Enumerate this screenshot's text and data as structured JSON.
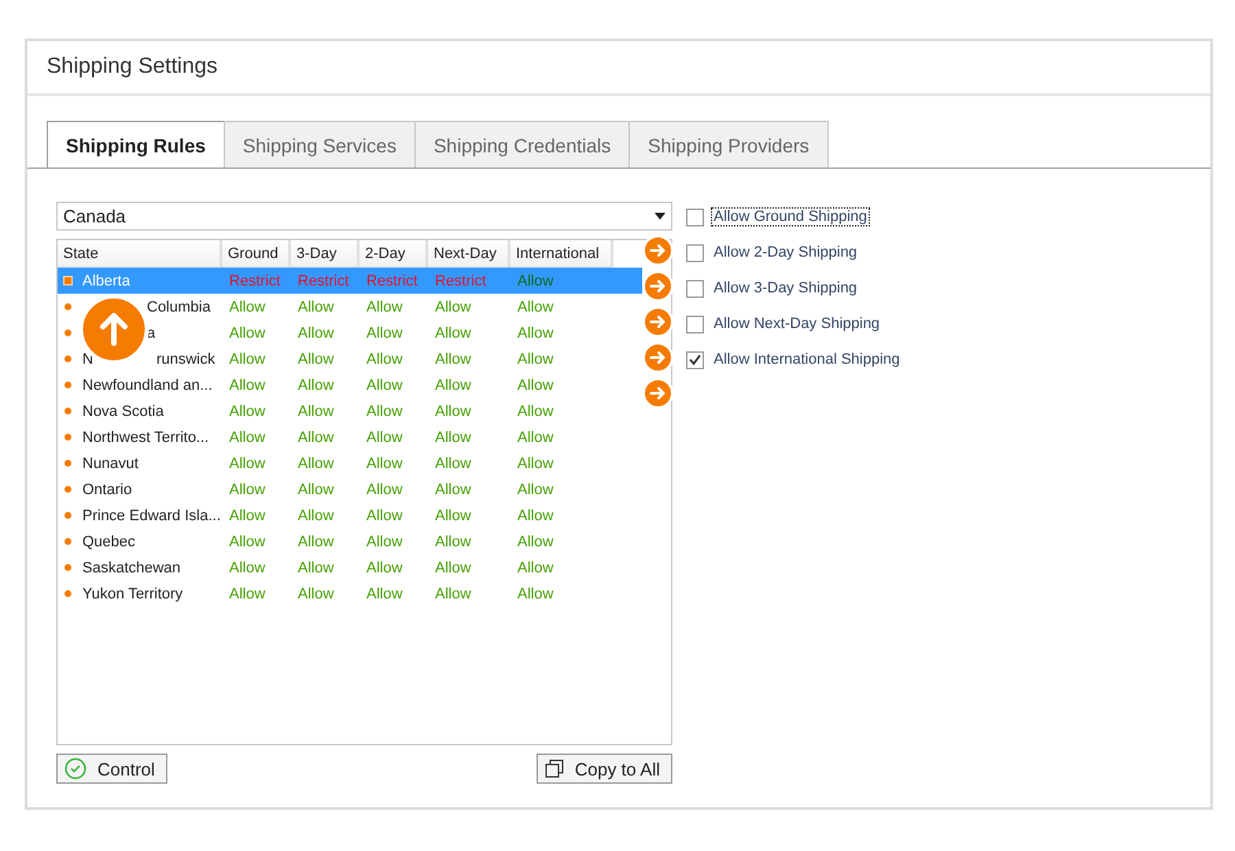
{
  "panel": {
    "title": "Shipping Settings"
  },
  "tabs": [
    {
      "label": "Shipping Rules",
      "selected": true
    },
    {
      "label": "Shipping Services",
      "selected": false
    },
    {
      "label": "Shipping Credentials",
      "selected": false
    },
    {
      "label": "Shipping Providers",
      "selected": false
    }
  ],
  "country_select": {
    "value": "Canada"
  },
  "table": {
    "columns": [
      "State",
      "Ground",
      "3-Day",
      "2-Day",
      "Next-Day",
      "International"
    ],
    "rows": [
      {
        "selected": true,
        "cells": [
          {
            "text": "Alberta",
            "kind": "state"
          },
          {
            "text": "Restrict",
            "kind": "restrict"
          },
          {
            "text": "Restrict",
            "kind": "restrict"
          },
          {
            "text": "Restrict",
            "kind": "restrict"
          },
          {
            "text": "Restrict",
            "kind": "restrict"
          },
          {
            "text": "Allow",
            "kind": "allow"
          }
        ]
      },
      {
        "selected": false,
        "covered": true,
        "cells": [
          {
            "text": "Columbia",
            "kind": "state"
          },
          {
            "text": "Allow",
            "kind": "allow"
          },
          {
            "text": "Allow",
            "kind": "allow"
          },
          {
            "text": "Allow",
            "kind": "allow"
          },
          {
            "text": "Allow",
            "kind": "allow"
          },
          {
            "text": "Allow",
            "kind": "allow"
          }
        ]
      },
      {
        "selected": false,
        "covered": true,
        "cells": [
          {
            "text": "a",
            "kind": "state"
          },
          {
            "text": "Allow",
            "kind": "allow"
          },
          {
            "text": "Allow",
            "kind": "allow"
          },
          {
            "text": "Allow",
            "kind": "allow"
          },
          {
            "text": "Allow",
            "kind": "allow"
          },
          {
            "text": "Allow",
            "kind": "allow"
          }
        ]
      },
      {
        "selected": false,
        "covered": true,
        "lead": "N",
        "cells": [
          {
            "text": "runswick",
            "kind": "state"
          },
          {
            "text": "Allow",
            "kind": "allow"
          },
          {
            "text": "Allow",
            "kind": "allow"
          },
          {
            "text": "Allow",
            "kind": "allow"
          },
          {
            "text": "Allow",
            "kind": "allow"
          },
          {
            "text": "Allow",
            "kind": "allow"
          }
        ]
      },
      {
        "selected": false,
        "cells": [
          {
            "text": "Newfoundland an...",
            "kind": "state"
          },
          {
            "text": "Allow",
            "kind": "allow"
          },
          {
            "text": "Allow",
            "kind": "allow"
          },
          {
            "text": "Allow",
            "kind": "allow"
          },
          {
            "text": "Allow",
            "kind": "allow"
          },
          {
            "text": "Allow",
            "kind": "allow"
          }
        ]
      },
      {
        "selected": false,
        "cells": [
          {
            "text": "Nova Scotia",
            "kind": "state"
          },
          {
            "text": "Allow",
            "kind": "allow"
          },
          {
            "text": "Allow",
            "kind": "allow"
          },
          {
            "text": "Allow",
            "kind": "allow"
          },
          {
            "text": "Allow",
            "kind": "allow"
          },
          {
            "text": "Allow",
            "kind": "allow"
          }
        ]
      },
      {
        "selected": false,
        "cells": [
          {
            "text": "Northwest Territo...",
            "kind": "state"
          },
          {
            "text": "Allow",
            "kind": "allow"
          },
          {
            "text": "Allow",
            "kind": "allow"
          },
          {
            "text": "Allow",
            "kind": "allow"
          },
          {
            "text": "Allow",
            "kind": "allow"
          },
          {
            "text": "Allow",
            "kind": "allow"
          }
        ]
      },
      {
        "selected": false,
        "cells": [
          {
            "text": "Nunavut",
            "kind": "state"
          },
          {
            "text": "Allow",
            "kind": "allow"
          },
          {
            "text": "Allow",
            "kind": "allow"
          },
          {
            "text": "Allow",
            "kind": "allow"
          },
          {
            "text": "Allow",
            "kind": "allow"
          },
          {
            "text": "Allow",
            "kind": "allow"
          }
        ]
      },
      {
        "selected": false,
        "cells": [
          {
            "text": "Ontario",
            "kind": "state"
          },
          {
            "text": "Allow",
            "kind": "allow"
          },
          {
            "text": "Allow",
            "kind": "allow"
          },
          {
            "text": "Allow",
            "kind": "allow"
          },
          {
            "text": "Allow",
            "kind": "allow"
          },
          {
            "text": "Allow",
            "kind": "allow"
          }
        ]
      },
      {
        "selected": false,
        "cells": [
          {
            "text": "Prince Edward Isla...",
            "kind": "state"
          },
          {
            "text": "Allow",
            "kind": "allow"
          },
          {
            "text": "Allow",
            "kind": "allow"
          },
          {
            "text": "Allow",
            "kind": "allow"
          },
          {
            "text": "Allow",
            "kind": "allow"
          },
          {
            "text": "Allow",
            "kind": "allow"
          }
        ]
      },
      {
        "selected": false,
        "cells": [
          {
            "text": "Quebec",
            "kind": "state"
          },
          {
            "text": "Allow",
            "kind": "allow"
          },
          {
            "text": "Allow",
            "kind": "allow"
          },
          {
            "text": "Allow",
            "kind": "allow"
          },
          {
            "text": "Allow",
            "kind": "allow"
          },
          {
            "text": "Allow",
            "kind": "allow"
          }
        ]
      },
      {
        "selected": false,
        "cells": [
          {
            "text": "Saskatchewan",
            "kind": "state"
          },
          {
            "text": "Allow",
            "kind": "allow"
          },
          {
            "text": "Allow",
            "kind": "allow"
          },
          {
            "text": "Allow",
            "kind": "allow"
          },
          {
            "text": "Allow",
            "kind": "allow"
          },
          {
            "text": "Allow",
            "kind": "allow"
          }
        ]
      },
      {
        "selected": false,
        "cells": [
          {
            "text": "Yukon Territory",
            "kind": "state"
          },
          {
            "text": "Allow",
            "kind": "allow"
          },
          {
            "text": "Allow",
            "kind": "allow"
          },
          {
            "text": "Allow",
            "kind": "allow"
          },
          {
            "text": "Allow",
            "kind": "allow"
          },
          {
            "text": "Allow",
            "kind": "allow"
          }
        ]
      }
    ]
  },
  "options": [
    {
      "label": "Allow Ground Shipping",
      "checked": false,
      "focused": true
    },
    {
      "label": "Allow 2-Day Shipping",
      "checked": false,
      "focused": false
    },
    {
      "label": "Allow 3-Day Shipping",
      "checked": false,
      "focused": false
    },
    {
      "label": "Allow Next-Day Shipping",
      "checked": false,
      "focused": false
    },
    {
      "label": "Allow International Shipping",
      "checked": true,
      "focused": false
    }
  ],
  "buttons": [
    {
      "label": "Control",
      "kind": "control"
    },
    {
      "label": "Copy to All",
      "kind": "copy"
    }
  ]
}
